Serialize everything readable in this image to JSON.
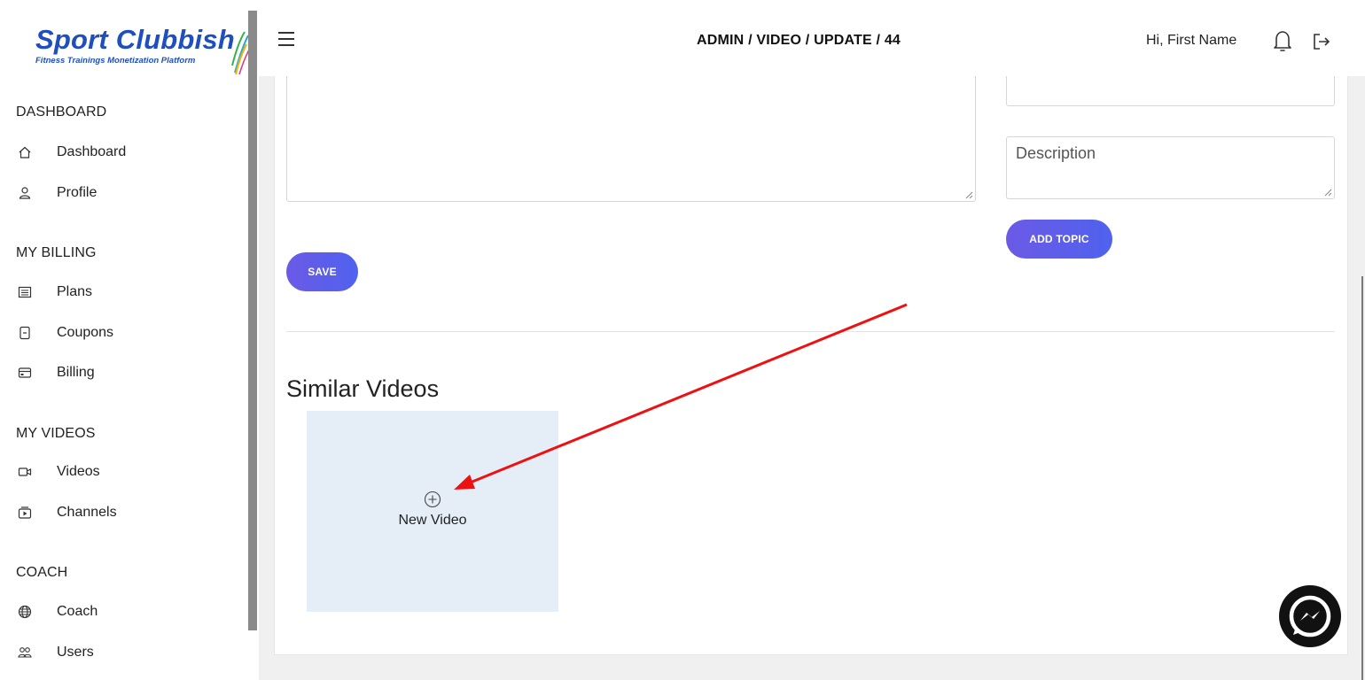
{
  "brand": {
    "title": "Sport Clubbish",
    "subtitle": "Fitness Trainings Monetization Platform"
  },
  "header": {
    "breadcrumb": "ADMIN / VIDEO / UPDATE / 44",
    "greeting": "Hi, First Name"
  },
  "sidebar": {
    "sections": [
      {
        "heading": "DASHBOARD",
        "items": [
          {
            "label": "Dashboard",
            "icon": "home-icon"
          },
          {
            "label": "Profile",
            "icon": "user-icon"
          }
        ]
      },
      {
        "heading": "MY BILLING",
        "items": [
          {
            "label": "Plans",
            "icon": "list-icon"
          },
          {
            "label": "Coupons",
            "icon": "coupon-icon"
          },
          {
            "label": "Billing",
            "icon": "credit-card-icon"
          }
        ]
      },
      {
        "heading": "MY VIDEOS",
        "items": [
          {
            "label": "Videos",
            "icon": "video-camera-icon"
          },
          {
            "label": "Channels",
            "icon": "channel-icon"
          }
        ]
      },
      {
        "heading": "COACH",
        "items": [
          {
            "label": "Coach",
            "icon": "globe-icon"
          },
          {
            "label": "Users",
            "icon": "users-icon"
          }
        ]
      }
    ]
  },
  "form": {
    "description_placeholder": "Description",
    "add_topic_label": "ADD TOPIC",
    "save_label": "SAVE"
  },
  "similar": {
    "title": "Similar Videos",
    "new_video_label": "New Video"
  },
  "colors": {
    "brand_blue": "#1f4fbf",
    "button_gradient_start": "#6b5ae6",
    "button_gradient_end": "#4f62ee",
    "tile_bg": "#e5eef7",
    "annotation_arrow": "#ee1111"
  }
}
